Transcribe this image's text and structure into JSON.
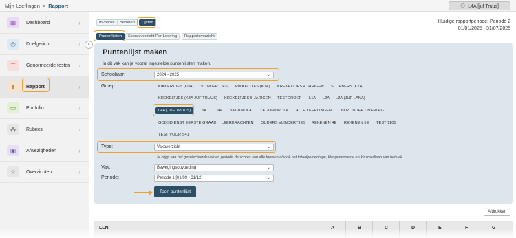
{
  "topbar": {
    "breadcrumb_root": "Mijn Leerlingen",
    "breadcrumb_sep": ">",
    "breadcrumb_current": "Rapport",
    "user_label": "L4A [juf Truus]"
  },
  "sidebar": {
    "collapse_glyph": "‹",
    "items": [
      {
        "label": "Dashboard",
        "icon": "▦",
        "color": "#e9d9f2",
        "fg": "#9a5fb8"
      },
      {
        "label": "Doelgericht",
        "icon": "◎",
        "color": "#dde9f3",
        "fg": "#4a7fa8"
      },
      {
        "label": "Genormeerde testen",
        "icon": "☰",
        "color": "#f7dede",
        "fg": "#c25a5a"
      },
      {
        "label": "Rapport",
        "icon": "▮",
        "color": "#f6e3d2",
        "fg": "#c98a4f"
      },
      {
        "label": "Portfolio",
        "icon": "▭",
        "color": "#e3efd6",
        "fg": "#6f9a3c"
      },
      {
        "label": "Rubrics",
        "icon": "⁂",
        "color": "#e6e6e6",
        "fg": "#666666"
      },
      {
        "label": "Afwezigheden",
        "icon": "▣",
        "color": "#e6e0f2",
        "fg": "#6a5aa8"
      },
      {
        "label": "Overzichten",
        "icon": "✧",
        "color": "#e6e6e6",
        "fg": "#666666"
      }
    ],
    "chevron": "›"
  },
  "tabs_top": [
    "Invoeren",
    "Beheren",
    "Lijsten"
  ],
  "tabs_sub": [
    "Puntenlijsten",
    "Scoreoverzicht Per Leerling",
    "Rapportoverzicht"
  ],
  "period": {
    "line1": "Huidige rapportperiode: Periode 2",
    "line2": "01/01/2025 - 31/07/2025"
  },
  "form": {
    "title": "Puntenlijst maken",
    "subtitle": "In dit vak kan je vooraf ingestelde puntenlijsten maken.",
    "schooljaar_label": "Schooljaar:",
    "schooljaar_value": "2024 - 2025",
    "groep_label": "Groep:",
    "groups_row1": [
      "KIKKERTJES (K0A)",
      "VLINDERTJES",
      "PINKELTJES (K1A)",
      "KREKELTJES 4 JARIGEN",
      "SLOEBERS (K2A)"
    ],
    "groups_row2": [
      "KREKELTJES (K3A JUF TRUUS)",
      "KREKELTJES 5 JARIGEN",
      "TESTGROEP",
      "L1A",
      "L2A",
      "L3A (JUF LANA)"
    ],
    "groups_row3": [
      "L4A (JUF TRUUS)",
      "L5A",
      "L6A",
      "3AT-BMOLA",
      "7AT-OMZWOLA",
      "ALLE LEERLINGEN",
      "BIJZONDER OVERLEG"
    ],
    "groups_row4": [
      "GODSDIENST EERSTE GRAAD",
      "LEERKRACHTEN",
      "OUDERS VLINDERTJES",
      "REKENEN 4E",
      "REKENEN 5E",
      "TEST 1105"
    ],
    "groups_row5": [
      "TEST VOOR S41"
    ],
    "type_label": "Type:",
    "type_value": "Vakoverzicht",
    "hint": "Je krijgt van het geselecteerde vak en periode de scores van alle toetsen alsook het totaalpercentage, klasgemiddelde en klasmediaan van het vak.",
    "vak_label": "Vak:",
    "vak_value": "Bewegingsopvoeding",
    "periode_label": "Periode:",
    "periode_value": "Periode 1 [01/09 - 31/12]",
    "submit_label": "Toon puntenlijst",
    "select_arrow": "⌄"
  },
  "print_label": "Afdrukken",
  "table": {
    "headers": [
      "LLN",
      "A",
      "B",
      "C",
      "D",
      "E",
      "F",
      "G"
    ]
  },
  "colors": {
    "accent": "#2c4f66",
    "highlight": "#f0a030",
    "panel": "#dde6ec"
  }
}
